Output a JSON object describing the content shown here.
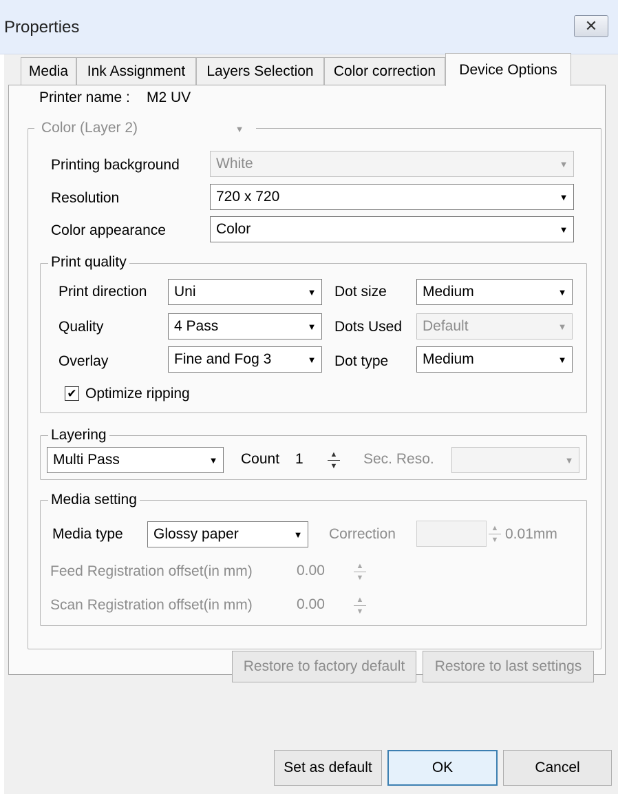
{
  "window": {
    "title": "Properties",
    "close_glyph": "✕"
  },
  "tabs": [
    {
      "label": "Media"
    },
    {
      "label": "Ink Assignment"
    },
    {
      "label": "Layers Selection"
    },
    {
      "label": "Color correction"
    },
    {
      "label": "Device Options",
      "active": true
    }
  ],
  "printer": {
    "label": "Printer name :",
    "value": "M2 UV"
  },
  "layer_select": {
    "value": "Color (Layer 2)"
  },
  "fields": {
    "printing_background": {
      "label": "Printing background",
      "value": "White"
    },
    "resolution": {
      "label": "Resolution",
      "value": "720 x 720"
    },
    "color_appearance": {
      "label": "Color appearance",
      "value": "Color"
    }
  },
  "print_quality": {
    "title": "Print quality",
    "print_direction": {
      "label": "Print direction",
      "value": "Uni"
    },
    "quality": {
      "label": "Quality",
      "value": "4 Pass"
    },
    "overlay": {
      "label": "Overlay",
      "value": "Fine and Fog 3"
    },
    "dot_size": {
      "label": "Dot size",
      "value": "Medium"
    },
    "dots_used": {
      "label": "Dots Used",
      "value": "Default"
    },
    "dot_type": {
      "label": "Dot type",
      "value": "Medium"
    },
    "optimize": {
      "label": "Optimize ripping",
      "checked": true,
      "check_glyph": "✔"
    }
  },
  "layering": {
    "title": "Layering",
    "mode": "Multi Pass",
    "count_label": "Count",
    "count_value": "1",
    "sec_reso_label": "Sec. Reso.",
    "sec_reso_value": ""
  },
  "media_setting": {
    "title": "Media setting",
    "media_type_label": "Media type",
    "media_type_value": "Glossy paper",
    "correction_label": "Correction",
    "correction_value": "",
    "correction_unit": "0.01mm",
    "feed_label": "Feed Registration offset(in mm)",
    "feed_value": "0.00",
    "scan_label": "Scan Registration offset(in mm)",
    "scan_value": "0.00"
  },
  "buttons": {
    "restore_factory": "Restore to factory default",
    "restore_last": "Restore to last settings",
    "set_default": "Set as default",
    "ok": "OK",
    "cancel": "Cancel"
  },
  "icons": {
    "dropdown_arrow": "▼",
    "spin_up": "▲",
    "spin_down": "▼"
  }
}
